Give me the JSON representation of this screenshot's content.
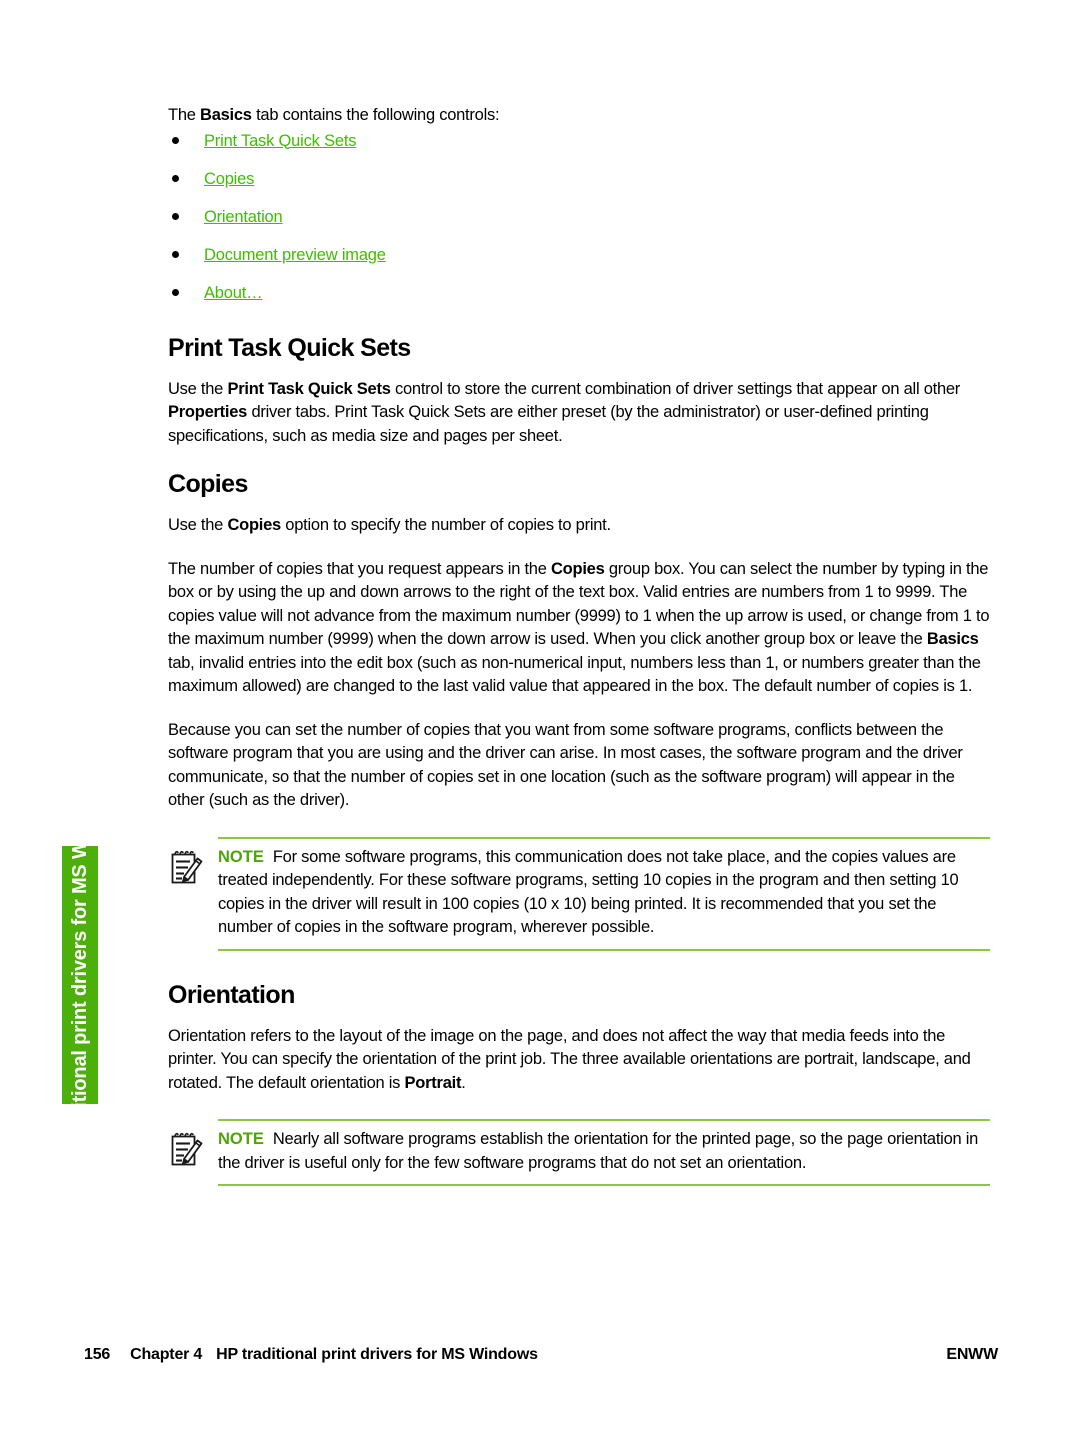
{
  "document": {
    "side_tab_label": "HP traditional print drivers for MS Windows"
  },
  "colors": {
    "tab_green": "#4DAF09",
    "link_green": "#3FBE00",
    "note_label_green": "#4FA409",
    "note_rule_green": "#8DC63F"
  },
  "intro": {
    "before": "The ",
    "bold": "Basics",
    "after": " tab contains the following controls:"
  },
  "link_list": [
    {
      "label": "Print Task Quick Sets"
    },
    {
      "label": "Copies"
    },
    {
      "label": "Orientation"
    },
    {
      "label": "Document preview image"
    },
    {
      "label": "About…"
    }
  ],
  "sections": [
    {
      "heading": "Print Task Quick Sets",
      "paragraph_1": {
        "p1": "Use the ",
        "b1": "Print Task Quick Sets",
        "p2": " control to store the current combination of driver settings that appear on all other ",
        "b2": "Properties",
        "p3": " driver tabs. Print Task Quick Sets are either preset (by the administrator) or user-defined printing specifications, such as media size and pages per sheet."
      }
    },
    {
      "heading": "Copies",
      "paragraph_1": {
        "p1": "Use the ",
        "b1": "Copies",
        "p2": " option to specify the number of copies to print."
      },
      "paragraph_2": {
        "p1": "The number of copies that you request appears in the ",
        "b1": "Copies",
        "p2": " group box. You can select the number by typing in the box or by using the up and down arrows to the right of the text box. Valid entries are numbers from 1 to 9999. The copies value will not advance from the maximum number (9999) to 1 when the up arrow is used, or change from 1 to the maximum number (9999) when the down arrow is used. When you click another group box or leave the ",
        "b2": "Basics",
        "p3": " tab, invalid entries into the edit box (such as non-numerical input, numbers less than 1, or numbers greater than the maximum allowed) are changed to the last valid value that appeared in the box. The default number of copies is 1."
      },
      "paragraph_3": "Because you can set the number of copies that you want from some software programs, conflicts between the software program that you are using and the driver can arise. In most cases, the software program and the driver communicate, so that the number of copies set in one location (such as the software program) will appear in the other (such as the driver).",
      "note": {
        "label": "NOTE",
        "text": "For some software programs, this communication does not take place, and the copies values are treated independently. For these software programs, setting 10 copies in the program and then setting 10 copies in the driver will result in 100 copies (10 x 10) being printed. It is recommended that you set the number of copies in the software program, wherever possible."
      }
    },
    {
      "heading": "Orientation",
      "paragraph_1": {
        "p1": "Orientation refers to the layout of the image on the page, and does not affect the way that media feeds into the printer. You can specify the orientation of the print job. The three available orientations are portrait, landscape, and rotated. The default orientation is ",
        "b1": "Portrait",
        "p2": "."
      },
      "note": {
        "label": "NOTE",
        "text": "Nearly all software programs establish the orientation for the printed page, so the page orientation in the driver is useful only for the few software programs that do not set an orientation."
      }
    }
  ],
  "footer": {
    "page_number": "156",
    "chapter": "Chapter 4",
    "chapter_title": "HP traditional print drivers for MS Windows",
    "right": "ENWW"
  }
}
